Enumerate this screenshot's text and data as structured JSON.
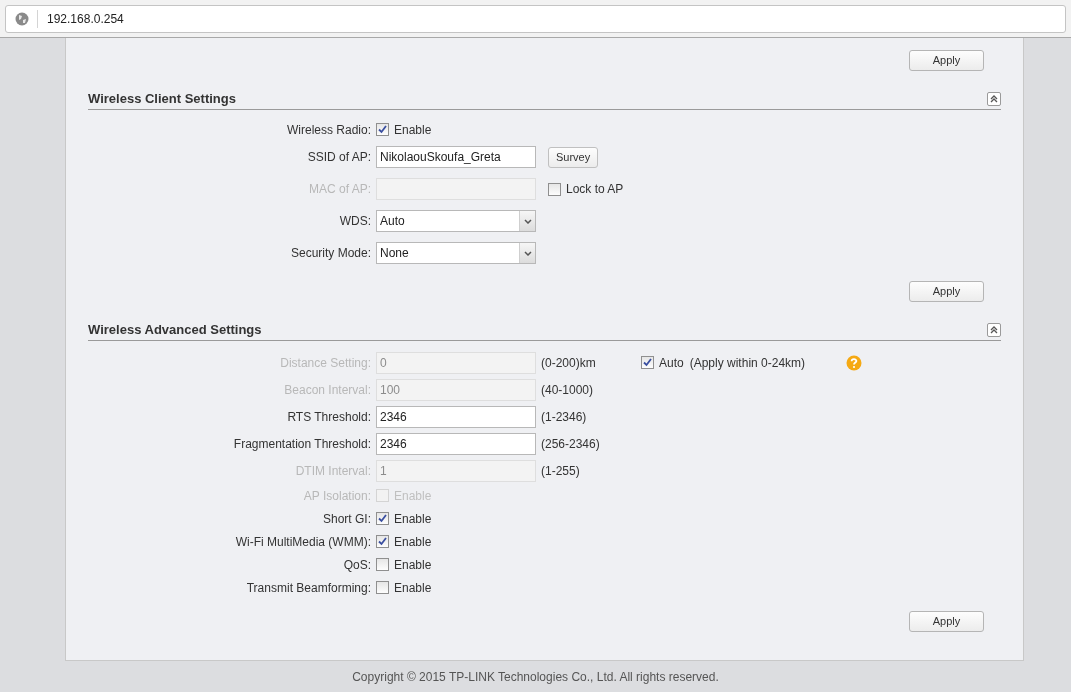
{
  "address_bar": {
    "url": "192.168.0.254"
  },
  "top_apply": "Apply",
  "sections": [
    {
      "title": "Wireless Client Settings",
      "apply": "Apply",
      "rows": [
        {
          "label": "Wireless Radio:",
          "kind": "checkbox",
          "disabled": false,
          "checked": true,
          "option": "Enable"
        },
        {
          "label": "SSID of AP:",
          "kind": "text",
          "disabled": false,
          "value": "NikolaouSkoufa_Greta",
          "button": "Survey"
        },
        {
          "label": "MAC of AP:",
          "kind": "text",
          "disabled": true,
          "extra_checkbox": {
            "label": "Lock to AP",
            "checked": false
          }
        },
        {
          "label": "WDS:",
          "kind": "select",
          "disabled": false,
          "value": "Auto"
        },
        {
          "label": "Security Mode:",
          "kind": "select",
          "disabled": false,
          "value": "None"
        }
      ]
    },
    {
      "title": "Wireless Advanced Settings",
      "apply": "Apply",
      "rows": [
        {
          "label": "Distance Setting:",
          "kind": "text",
          "disabled": true,
          "value": "0",
          "hint": "(0-200)km",
          "extra_checkbox": {
            "label": "Auto",
            "checked": true,
            "note": "(Apply within 0-24km)",
            "help": true
          }
        },
        {
          "label": "Beacon Interval:",
          "kind": "text",
          "disabled": true,
          "value": "100",
          "hint": "(40-1000)"
        },
        {
          "label": "RTS Threshold:",
          "kind": "text",
          "disabled": false,
          "value": "2346",
          "hint": "(1-2346)"
        },
        {
          "label": "Fragmentation Threshold:",
          "kind": "text",
          "disabled": false,
          "value": "2346",
          "hint": "(256-2346)"
        },
        {
          "label": "DTIM Interval:",
          "kind": "text",
          "disabled": true,
          "value": "1",
          "hint": "(1-255)"
        },
        {
          "label": "AP Isolation:",
          "kind": "checkbox",
          "disabled": true,
          "checked": false,
          "option": "Enable"
        },
        {
          "label": "Short GI:",
          "kind": "checkbox",
          "disabled": false,
          "checked": true,
          "option": "Enable"
        },
        {
          "label": "Wi-Fi MultiMedia (WMM):",
          "kind": "checkbox",
          "disabled": false,
          "checked": true,
          "option": "Enable"
        },
        {
          "label": "QoS:",
          "kind": "checkbox",
          "disabled": false,
          "checked": false,
          "option": "Enable"
        },
        {
          "label": "Transmit Beamforming:",
          "kind": "checkbox",
          "disabled": false,
          "checked": false,
          "option": "Enable"
        }
      ]
    }
  ],
  "footer": "Copyright © 2015 TP-LINK Technologies Co., Ltd. All rights reserved."
}
